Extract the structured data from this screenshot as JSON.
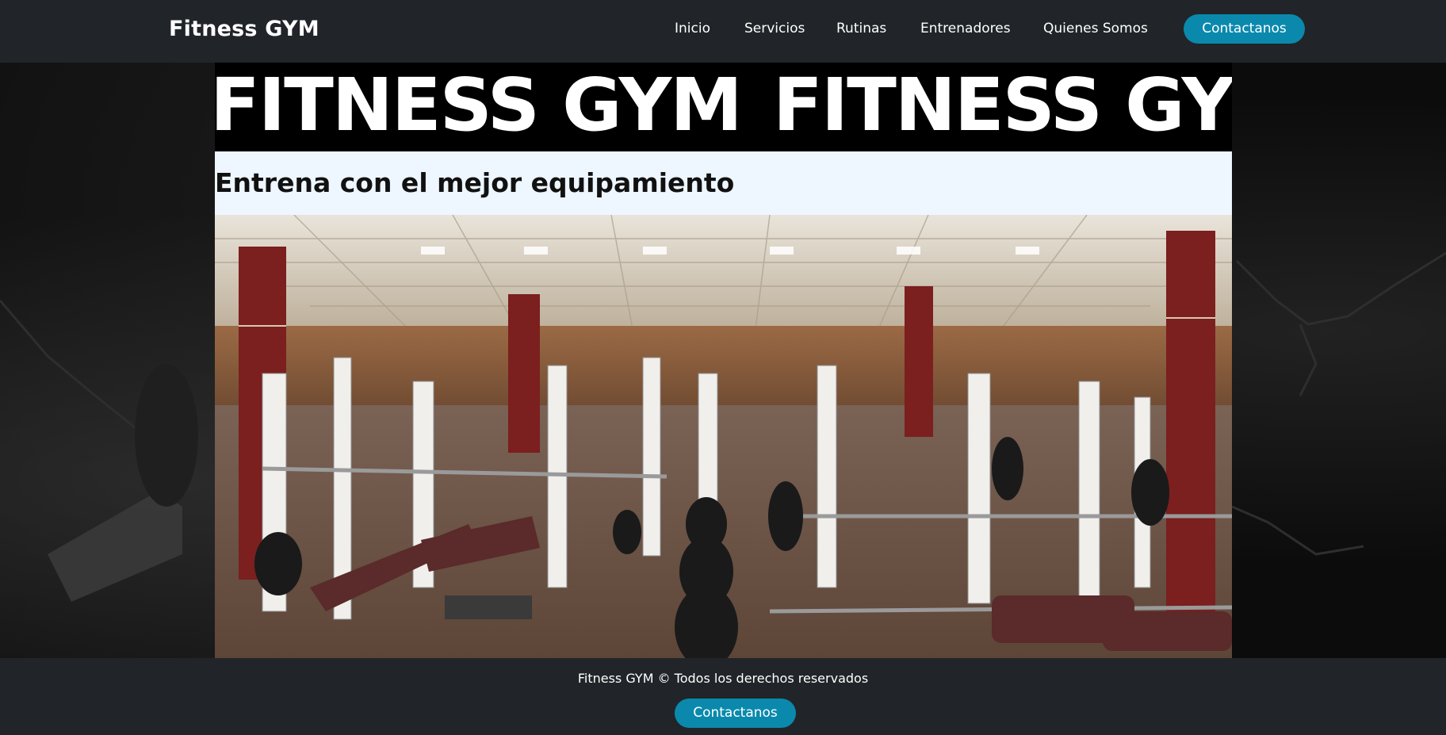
{
  "navbar": {
    "brand": "Fitness GYM",
    "links": [
      "Inicio",
      "Servicios",
      "Rutinas",
      "Entrenadores",
      "Quienes Somos"
    ],
    "cta_label": "Contactanos"
  },
  "hero": {
    "marquee_text": "FITNESS GYM",
    "tagline": "Entrena con el mejor equipamiento",
    "photo_alt": "Gym interior with weight racks and benches"
  },
  "footer": {
    "copyright": "Fitness GYM © Todos los derechos reservados",
    "cta_label": "Contactanos"
  },
  "colors": {
    "navbar_bg": "#212529",
    "accent": "#0a89ad",
    "tagline_bg": "#eef6ff"
  }
}
